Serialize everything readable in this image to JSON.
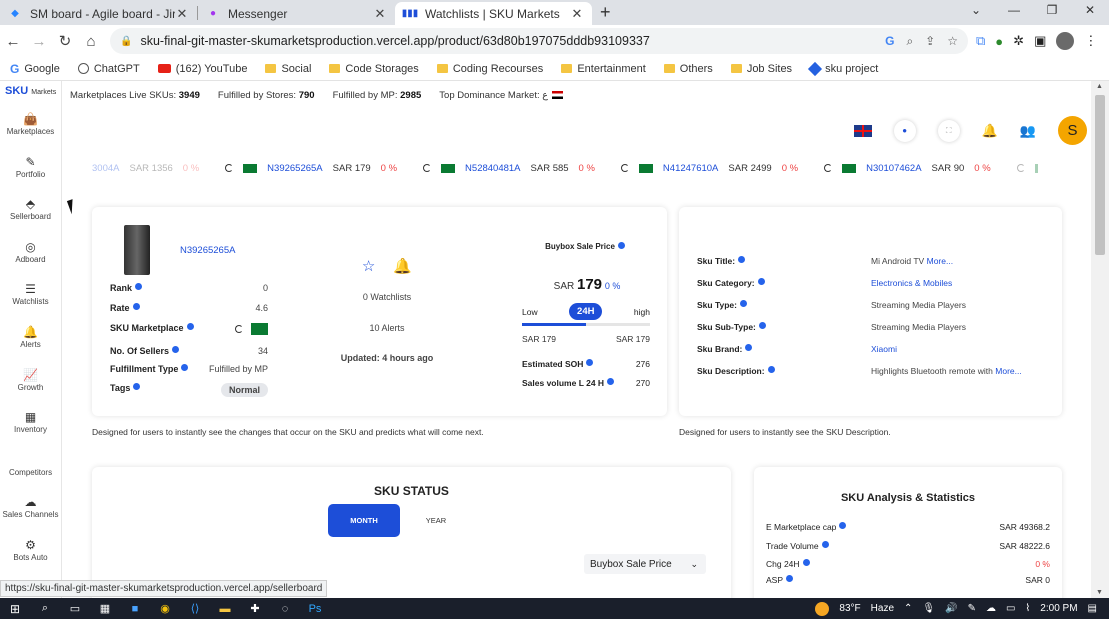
{
  "browser": {
    "tabs": [
      {
        "title": "SM board - Agile board - Jira",
        "active": false
      },
      {
        "title": "Messenger",
        "active": false
      },
      {
        "title": "Watchlists | SKU Markets",
        "active": true
      }
    ],
    "url": "sku-final-git-master-skumarketsproduction.vercel.app/product/63d80b197075dddb93109337",
    "bookmarks": [
      "Google",
      "ChatGPT",
      "(162) YouTube",
      "Social",
      "Code Storages",
      "Coding Recourses",
      "Entertainment",
      "Others",
      "Job Sites",
      "sku project"
    ],
    "status_url": "https://sku-final-git-master-skumarketsproduction.vercel.app/sellerboard"
  },
  "brand": {
    "name": "SKU",
    "sub": "Markets"
  },
  "sidebar": {
    "items": [
      "Marketplaces",
      "Portfolio",
      "Sellerboard",
      "Adboard",
      "Watchlists",
      "Alerts",
      "Growth",
      "Inventory",
      "Competitors",
      "Sales Channels",
      "Bots Auto"
    ]
  },
  "topstats": {
    "live_label": "Marketplaces Live SKUs:",
    "live_value": "3949",
    "stores_label": "Fulfilled by Stores:",
    "stores_value": "790",
    "mp_label": "Fulfilled by MP:",
    "mp_value": "2985",
    "dominance_label": "Top Dominance Market:",
    "dominance_value": "ع"
  },
  "header": {
    "avatar_letter": "S"
  },
  "ticker": [
    {
      "code": "3004A",
      "price": "SAR 1356",
      "pct": "0 %",
      "faded": true
    },
    {
      "code": "N39265265A",
      "price": "SAR 179",
      "pct": "0 %",
      "faded": false
    },
    {
      "code": "N52840481A",
      "price": "SAR 585",
      "pct": "0 %",
      "faded": false
    },
    {
      "code": "N41247610A",
      "price": "SAR 2499",
      "pct": "0 %",
      "faded": false
    },
    {
      "code": "N30107462A",
      "price": "SAR 90",
      "pct": "0 %",
      "faded": false
    }
  ],
  "product": {
    "code": "N39265265A",
    "rank_label": "Rank",
    "rank": "0",
    "rate_label": "Rate",
    "rate": "4.6",
    "marketplace_label": "SKU Marketplace",
    "sellers_label": "No. Of Sellers",
    "sellers": "34",
    "fulfillment_label": "Fulfillment Type",
    "fulfillment": "Fulfilled by MP",
    "tags_label": "Tags",
    "tag": "Normal",
    "watchlists": "0 Watchlists",
    "alerts": "10 Alerts",
    "updated_label": "Updated:",
    "updated": "4 hours ago",
    "buybox_label": "Buybox Sale Price",
    "currency": "SAR",
    "price": "179",
    "price_pct": "0 %",
    "low_label": "Low",
    "high_label": "high",
    "period": "24H",
    "low_price": "SAR 179",
    "high_price": "SAR 179",
    "range_fill": 0.5,
    "soh_label": "Estimated SOH",
    "soh": "276",
    "sales_label": "Sales volume L 24 H",
    "sales": "270",
    "caption": "Designed for users to instantly see the changes that occur on the SKU and predicts what will come next."
  },
  "description": {
    "rows": [
      {
        "k": "Sku Title:",
        "v": "Mi Android TV",
        "more": "More...",
        "link": false
      },
      {
        "k": "Sku Category:",
        "v": "Electronics & Mobiles",
        "more": "",
        "link": true
      },
      {
        "k": "Sku Type:",
        "v": "Streaming Media Players",
        "more": "",
        "link": false
      },
      {
        "k": "Sku Sub-Type:",
        "v": "Streaming Media Players",
        "more": "",
        "link": false
      },
      {
        "k": "Sku Brand:",
        "v": "Xiaomi",
        "more": "",
        "link": true
      },
      {
        "k": "Sku Description:",
        "v": "Highlights Bluetooth remote with",
        "more": "More...",
        "link": false
      }
    ],
    "caption": "Designed for users to instantly see the SKU Description."
  },
  "status": {
    "title": "SKU STATUS",
    "month": "MONTH",
    "year": "YEAR",
    "select": "Buybox Sale Price"
  },
  "analysis": {
    "title": "SKU Analysis & Statistics",
    "rows": [
      {
        "k": "E Marketplace cap",
        "v": "SAR 49368.2",
        "red": false
      },
      {
        "k": "Trade Volume",
        "v": "SAR 48222.6",
        "red": false
      },
      {
        "k": "Chg 24H",
        "v": "0 %",
        "red": true
      },
      {
        "k": "ASP",
        "v": "SAR 0",
        "red": false
      }
    ]
  },
  "taskbar": {
    "temp": "83°F",
    "weather": "Haze",
    "time": "2:00 PM"
  },
  "colors": {
    "accent": "#1d4ed8",
    "avatar": "#f4a500",
    "negative": "#e44444"
  }
}
